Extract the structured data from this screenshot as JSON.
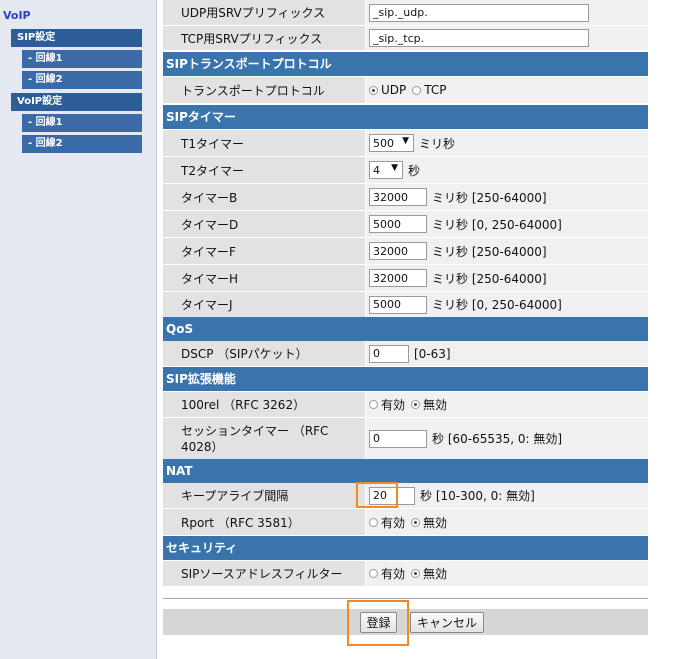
{
  "sidebar": {
    "title": "VoIP",
    "items": [
      {
        "label": "SIP設定",
        "level": "main"
      },
      {
        "label": "- 回線1",
        "level": "sub"
      },
      {
        "label": "- 回線2",
        "level": "sub"
      },
      {
        "label": "VoIP設定",
        "level": "main"
      },
      {
        "label": "- 回線1",
        "level": "sub"
      },
      {
        "label": "- 回線2",
        "level": "sub"
      }
    ]
  },
  "srv": {
    "udp_label": "UDP用SRVプリフィックス",
    "udp_value": "_sip._udp.",
    "tcp_label": "TCP用SRVプリフィックス",
    "tcp_value": "_sip._tcp."
  },
  "transport": {
    "section": "SIPトランスポートプロトコル",
    "label": "トランスポートプロトコル",
    "options": [
      "UDP",
      "TCP"
    ],
    "selected": "UDP"
  },
  "timer": {
    "section": "SIPタイマー",
    "t1_label": "T1タイマー",
    "t1_value": "500",
    "t1_unit": "ミリ秒",
    "t2_label": "T2タイマー",
    "t2_value": "4",
    "t2_unit": "秒",
    "b_label": "タイマーB",
    "b_value": "32000",
    "b_unit": "ミリ秒 [250-64000]",
    "d_label": "タイマーD",
    "d_value": "5000",
    "d_unit": "ミリ秒 [0, 250-64000]",
    "f_label": "タイマーF",
    "f_value": "32000",
    "f_unit": "ミリ秒 [250-64000]",
    "h_label": "タイマーH",
    "h_value": "32000",
    "h_unit": "ミリ秒 [250-64000]",
    "j_label": "タイマーJ",
    "j_value": "5000",
    "j_unit": "ミリ秒 [0, 250-64000]"
  },
  "qos": {
    "section": "QoS",
    "dscp_label": "DSCP （SIPパケット）",
    "dscp_value": "0",
    "dscp_unit": "[0-63]"
  },
  "ext": {
    "section": "SIP拡張機能",
    "rel_label": "100rel （RFC 3262）",
    "rel_options": [
      "有効",
      "無効"
    ],
    "rel_selected": "無効",
    "session_label": "セッションタイマー （RFC 4028）",
    "session_value": "0",
    "session_unit": "秒 [60-65535, 0: 無効]"
  },
  "nat": {
    "section": "NAT",
    "keepalive_label": "キープアライブ間隔",
    "keepalive_value": "20",
    "keepalive_unit": "秒 [10-300, 0: 無効]",
    "rport_label": "Rport （RFC 3581）",
    "rport_options": [
      "有効",
      "無効"
    ],
    "rport_selected": "無効"
  },
  "security": {
    "section": "セキュリティ",
    "filter_label": "SIPソースアドレスフィルター",
    "filter_options": [
      "有効",
      "無効"
    ],
    "filter_selected": "無効"
  },
  "footer": {
    "submit_label": "登録",
    "cancel_label": "キャンセル"
  },
  "colors": {
    "section_header": "#3a74ad",
    "sidebar_item": "#2d5e99",
    "highlight": "#f08a24"
  }
}
